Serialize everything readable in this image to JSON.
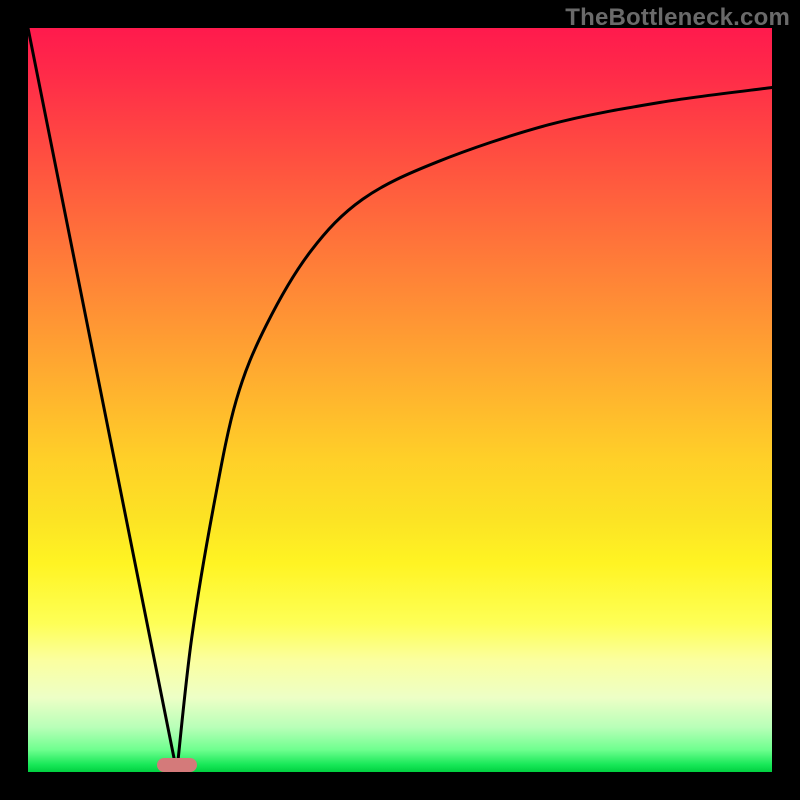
{
  "watermark": "TheBottleneck.com",
  "colors": {
    "frame": "#000000",
    "curve": "#000000",
    "marker": "#d47a7a",
    "watermark": "#6a6a6a"
  },
  "chart_data": {
    "type": "line",
    "title": "",
    "xlabel": "",
    "ylabel": "",
    "xlim": [
      0,
      100
    ],
    "ylim": [
      0,
      100
    ],
    "grid": false,
    "legend": false,
    "series": [
      {
        "name": "left-descent",
        "x": [
          0,
          20
        ],
        "values": [
          100,
          0
        ]
      },
      {
        "name": "right-rise",
        "x": [
          20,
          22,
          25,
          28,
          32,
          38,
          45,
          55,
          70,
          85,
          100
        ],
        "values": [
          0,
          18,
          36,
          50,
          60,
          70,
          77,
          82,
          87,
          90,
          92
        ]
      }
    ],
    "marker": {
      "x_center": 20,
      "x_width": 5.4,
      "y": 0
    }
  }
}
